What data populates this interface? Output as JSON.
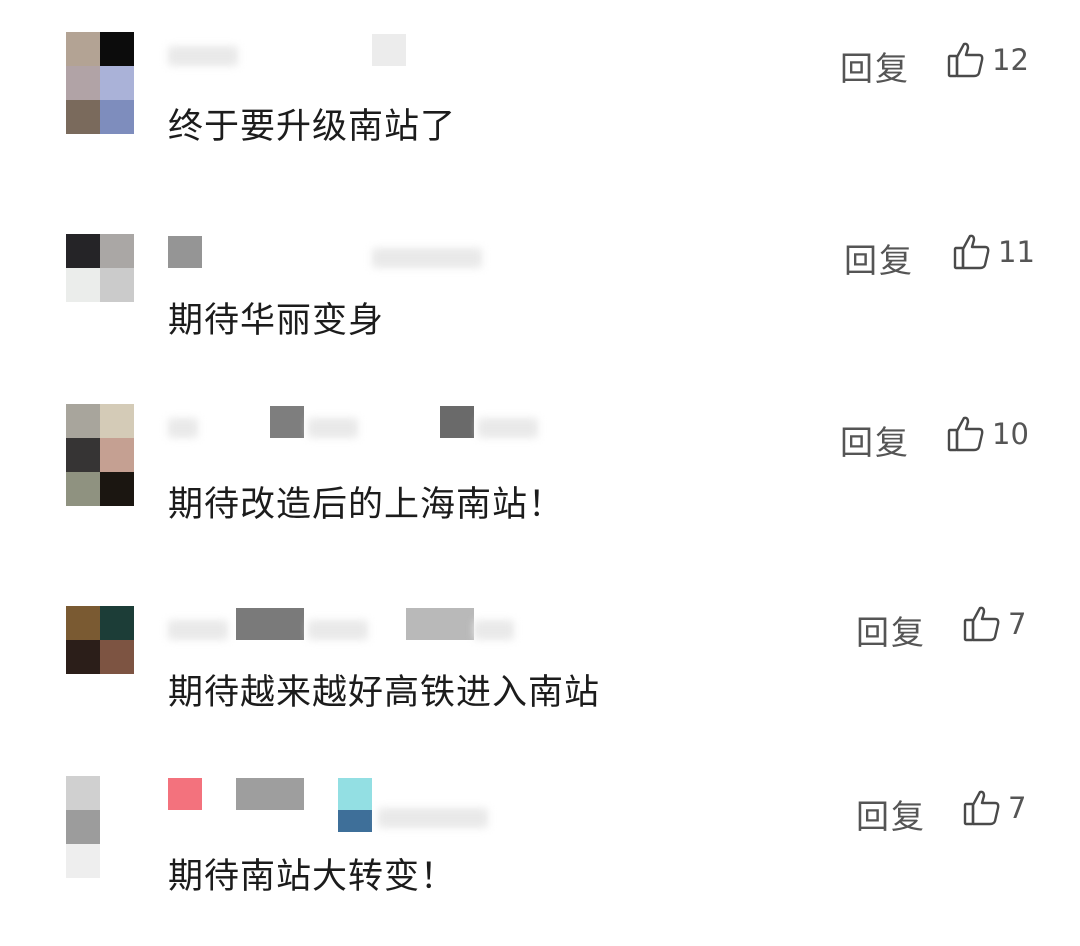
{
  "reply_label": "回复",
  "comments": [
    {
      "text": "终于要升级南站了",
      "likes": "12"
    },
    {
      "text": "期待华丽变身",
      "likes": "11"
    },
    {
      "text": "期待改造后的上海南站！",
      "likes": "10"
    },
    {
      "text": "期待越来越好高铁进入南站",
      "likes": "7"
    },
    {
      "text": "期待南站大转变！",
      "likes": "7"
    }
  ]
}
